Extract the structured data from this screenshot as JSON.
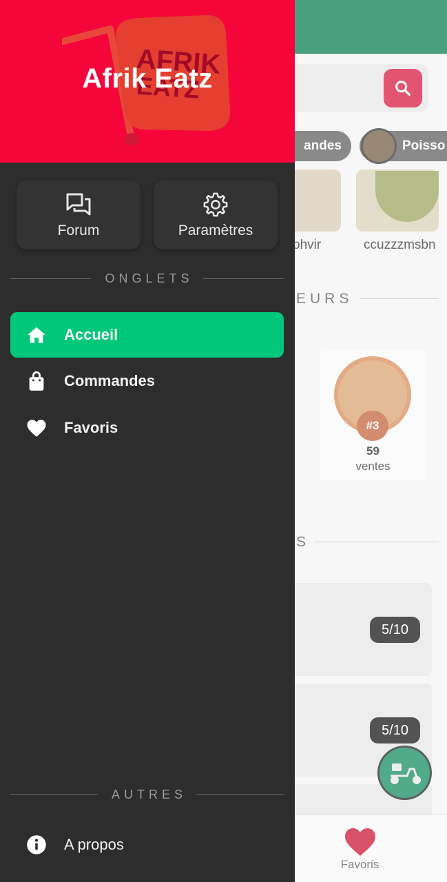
{
  "app": {
    "title": "Afrik Eatz",
    "logo_text": "AFRIK EATZ"
  },
  "colors": {
    "header": "#f4063a",
    "drawer": "#2d2d2d",
    "accent_active": "#00c77a",
    "topbar": "#007a4b"
  },
  "tiles": [
    {
      "label": "Forum",
      "icon": "forum-icon"
    },
    {
      "label": "Paramètres",
      "icon": "gear-icon"
    }
  ],
  "sections": {
    "tabs": "ONGLETS",
    "others": "AUTRES"
  },
  "nav": {
    "items": [
      {
        "label": "Accueil",
        "icon": "home-icon",
        "active": true
      },
      {
        "label": "Commandes",
        "icon": "shopping-bag-icon",
        "active": false
      },
      {
        "label": "Favoris",
        "icon": "heart-icon",
        "active": false
      }
    ],
    "about": {
      "label": "A propos",
      "icon": "info-icon"
    }
  },
  "background": {
    "chips": [
      "andes",
      "Poisso"
    ],
    "product_labels": [
      "ohvir",
      "ccuzzzmsbn"
    ],
    "section_sellers": "EURS",
    "section_other": "S",
    "seller": {
      "rank": "#3",
      "count": "59",
      "unit": "ventes"
    },
    "ratings": [
      "5/10",
      "5/10"
    ],
    "bottom_nav_label": "Favoris"
  }
}
